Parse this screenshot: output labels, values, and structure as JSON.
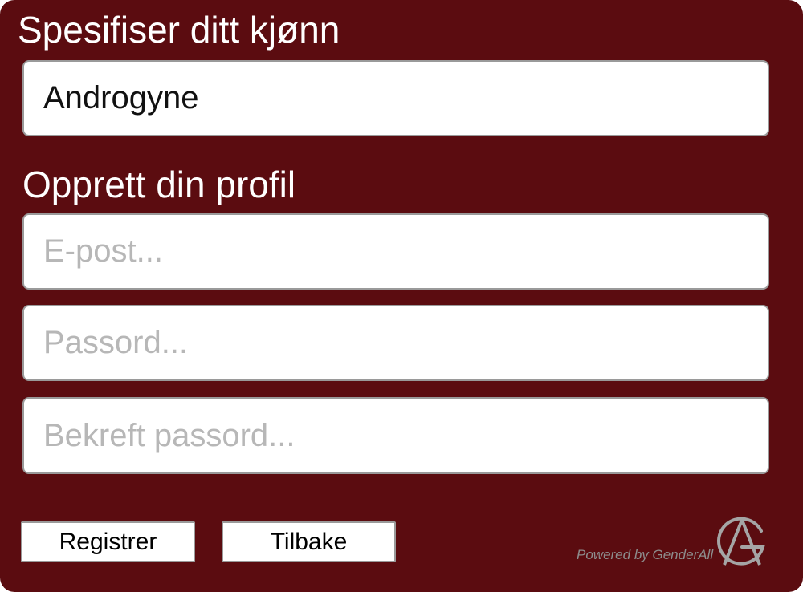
{
  "gender_section": {
    "heading": "Spesifiser ditt kjønn",
    "value": "Androgyne"
  },
  "profile_section": {
    "heading": "Opprett din profil",
    "email_placeholder": "E-post...",
    "password_placeholder": "Passord...",
    "confirm_placeholder": "Bekreft passord..."
  },
  "actions": {
    "register_label": "Registrer",
    "back_label": "Tilbake"
  },
  "footer": {
    "powered_by": "Powered by GenderAll",
    "logo_icon": "genderall-logo-icon"
  },
  "colors": {
    "panel_background": "#5b0c10",
    "field_border": "#9a9a9a",
    "placeholder": "#b7b7b7",
    "footer_text": "#8d8d8d"
  }
}
